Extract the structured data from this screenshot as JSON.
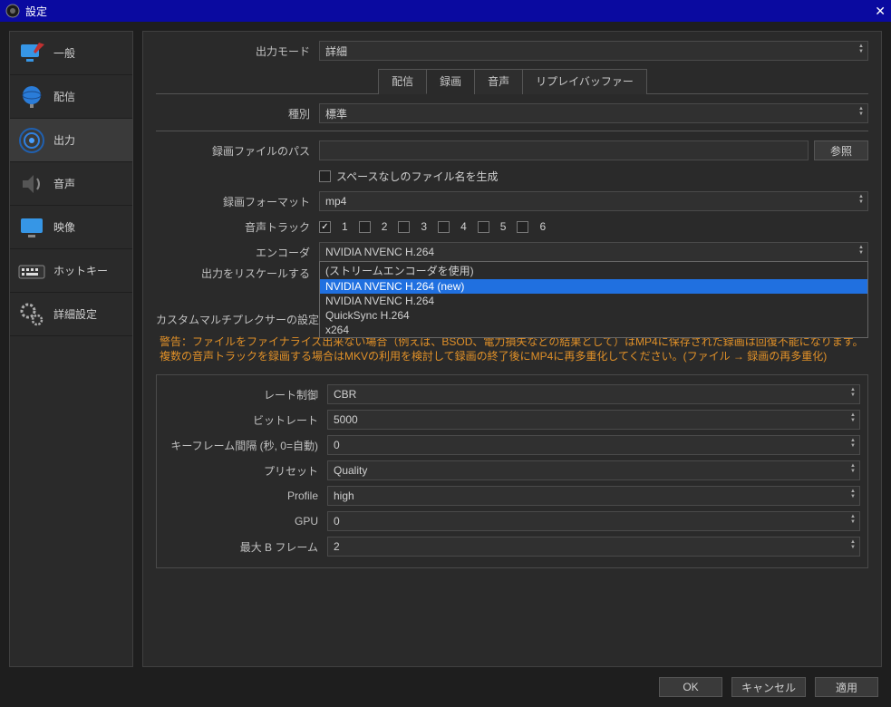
{
  "window": {
    "title": "設定"
  },
  "sidebar": {
    "items": [
      {
        "label": "一般"
      },
      {
        "label": "配信"
      },
      {
        "label": "出力"
      },
      {
        "label": "音声"
      },
      {
        "label": "映像"
      },
      {
        "label": "ホットキー"
      },
      {
        "label": "詳細設定"
      }
    ]
  },
  "top": {
    "mode_label": "出力モード",
    "mode_value": "詳細"
  },
  "tabs": {
    "items": [
      {
        "label": "配信"
      },
      {
        "label": "録画"
      },
      {
        "label": "音声"
      },
      {
        "label": "リプレイバッファー"
      }
    ]
  },
  "rec": {
    "type_label": "種別",
    "type_value": "標準",
    "path_label": "録画ファイルのパス",
    "path_value": "",
    "browse": "参照",
    "noSpace_label": "スペースなしのファイル名を生成",
    "format_label": "録画フォーマット",
    "format_value": "mp4",
    "tracks_label": "音声トラック",
    "tracks": [
      "1",
      "2",
      "3",
      "4",
      "5",
      "6"
    ],
    "encoder_label": "エンコーダ",
    "encoder_value": "NVIDIA NVENC H.264",
    "encoder_options": [
      "(ストリームエンコーダを使用)",
      "NVIDIA NVENC H.264 (new)",
      "NVIDIA NVENC H.264",
      "QuickSync H.264",
      "x264"
    ],
    "rescale_label": "出力をリスケールする",
    "mux_label": "カスタムマルチプレクサーの設定",
    "mux_value": "",
    "warning": "警告：ファイルをファイナライズ出来ない場合（例えば、BSOD、電力損失などの結果として）はMP4に保存された録画は回復不能になります。複数の音声トラックを録画する場合はMKVの利用を検討して録画の終了後にMP4に再多重化してください。(ファイル → 録画の再多重化)"
  },
  "enc": {
    "rate_label": "レート制御",
    "rate_value": "CBR",
    "bitrate_label": "ビットレート",
    "bitrate_value": "5000",
    "keyframe_label": "キーフレーム間隔 (秒, 0=自動)",
    "keyframe_value": "0",
    "preset_label": "プリセット",
    "preset_value": "Quality",
    "profile_label": "Profile",
    "profile_value": "high",
    "gpu_label": "GPU",
    "gpu_value": "0",
    "bframes_label": "最大 B フレーム",
    "bframes_value": "2"
  },
  "footer": {
    "ok": "OK",
    "cancel": "キャンセル",
    "apply": "適用"
  }
}
